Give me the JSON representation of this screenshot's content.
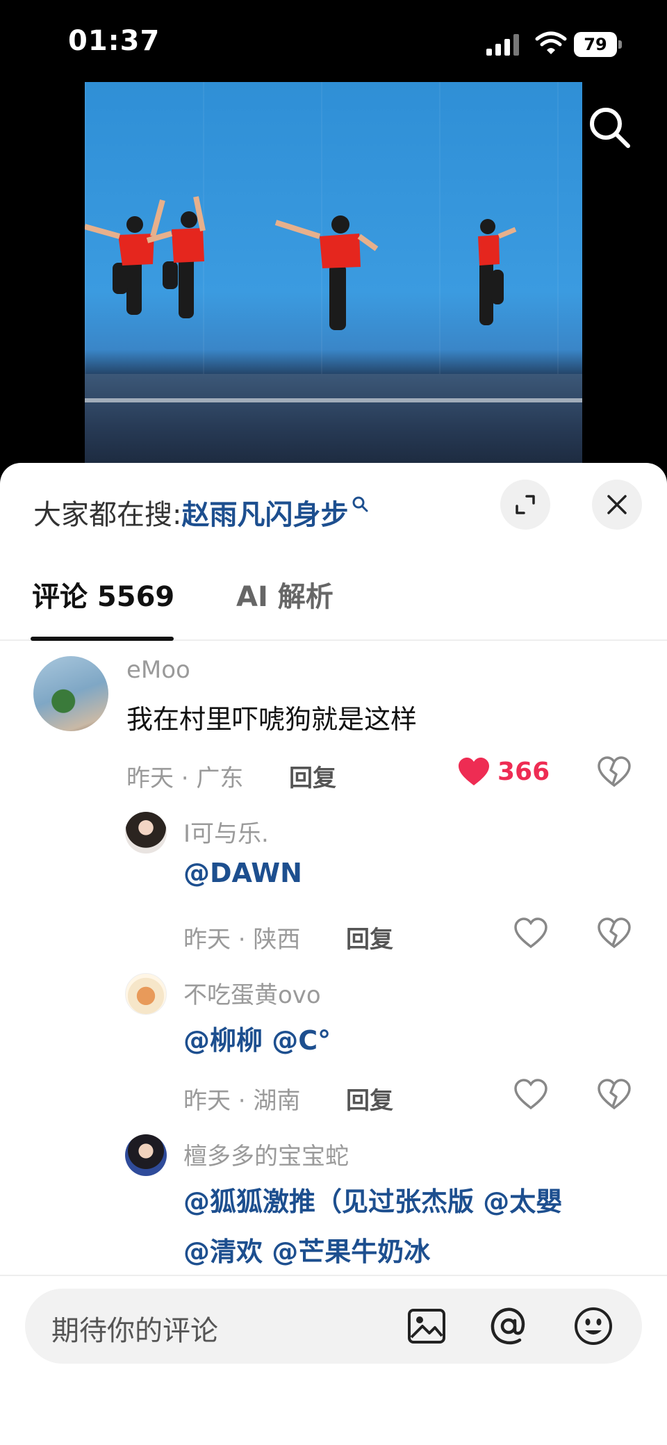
{
  "status": {
    "time": "01:37",
    "battery": "79"
  },
  "video": {
    "description_icon": "search-icon"
  },
  "sheet": {
    "hot_search_label": "大家都在搜:",
    "hot_search_term": "赵雨凡闪身步",
    "tabs": [
      {
        "label": "评论 5569"
      },
      {
        "label": "AI 解析"
      }
    ]
  },
  "comments": [
    {
      "user": "eMoo",
      "text": "我在村里吓唬狗就是这样",
      "meta": "昨天 · 广东",
      "reply": "回复",
      "likes": "366",
      "liked": true
    },
    {
      "user": "I可与乐.",
      "text": "@DAWN",
      "meta": "昨天 · 陕西",
      "reply": "回复"
    },
    {
      "user": "不吃蛋黄ovo",
      "text": "@柳柳  @C°",
      "meta": "昨天 · 湖南",
      "reply": "回复"
    },
    {
      "user": "檀多多的宝宝蛇",
      "text_line1": "@狐狐激推（见过张杰版 @太嬰",
      "text_line2": "@清欢  @芒果牛奶冰"
    }
  ],
  "input": {
    "placeholder": "期待你的评论"
  },
  "colors": {
    "like": "#ee2c53",
    "mention": "#1d4f8f"
  }
}
